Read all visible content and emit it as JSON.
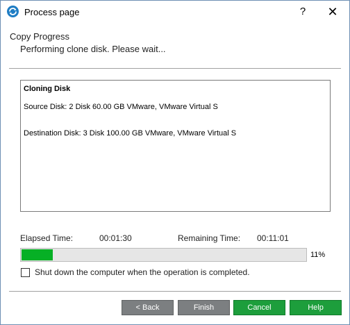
{
  "window": {
    "title": "Process page",
    "help_glyph": "?",
    "close_glyph": "✕"
  },
  "header": {
    "title": "Copy Progress",
    "subtitle": "Performing clone disk. Please wait..."
  },
  "log": {
    "heading": "Cloning Disk",
    "source": "Source Disk: 2 Disk 60.00 GB VMware, VMware Virtual S",
    "destination": "Destination Disk: 3 Disk 100.00 GB VMware, VMware Virtual S"
  },
  "timing": {
    "elapsed_label": "Elapsed Time:",
    "elapsed_value": "00:01:30",
    "remaining_label": "Remaining Time:",
    "remaining_value": "00:11:01"
  },
  "progress": {
    "percent": 11,
    "percent_label": "11%",
    "fill_color": "#06b025"
  },
  "shutdown_option": {
    "label": "Shut down the computer when the operation is completed.",
    "checked": false
  },
  "buttons": {
    "back": "< Back",
    "finish": "Finish",
    "cancel": "Cancel",
    "help": "Help"
  },
  "colors": {
    "disabled_button": "#7c7f81",
    "active_button": "#1d9e3c",
    "app_icon": "#1f7dc4"
  },
  "icons": {
    "app": "app-logo-icon",
    "help": "help-icon",
    "close": "close-icon",
    "checkbox": "checkbox-unchecked"
  }
}
